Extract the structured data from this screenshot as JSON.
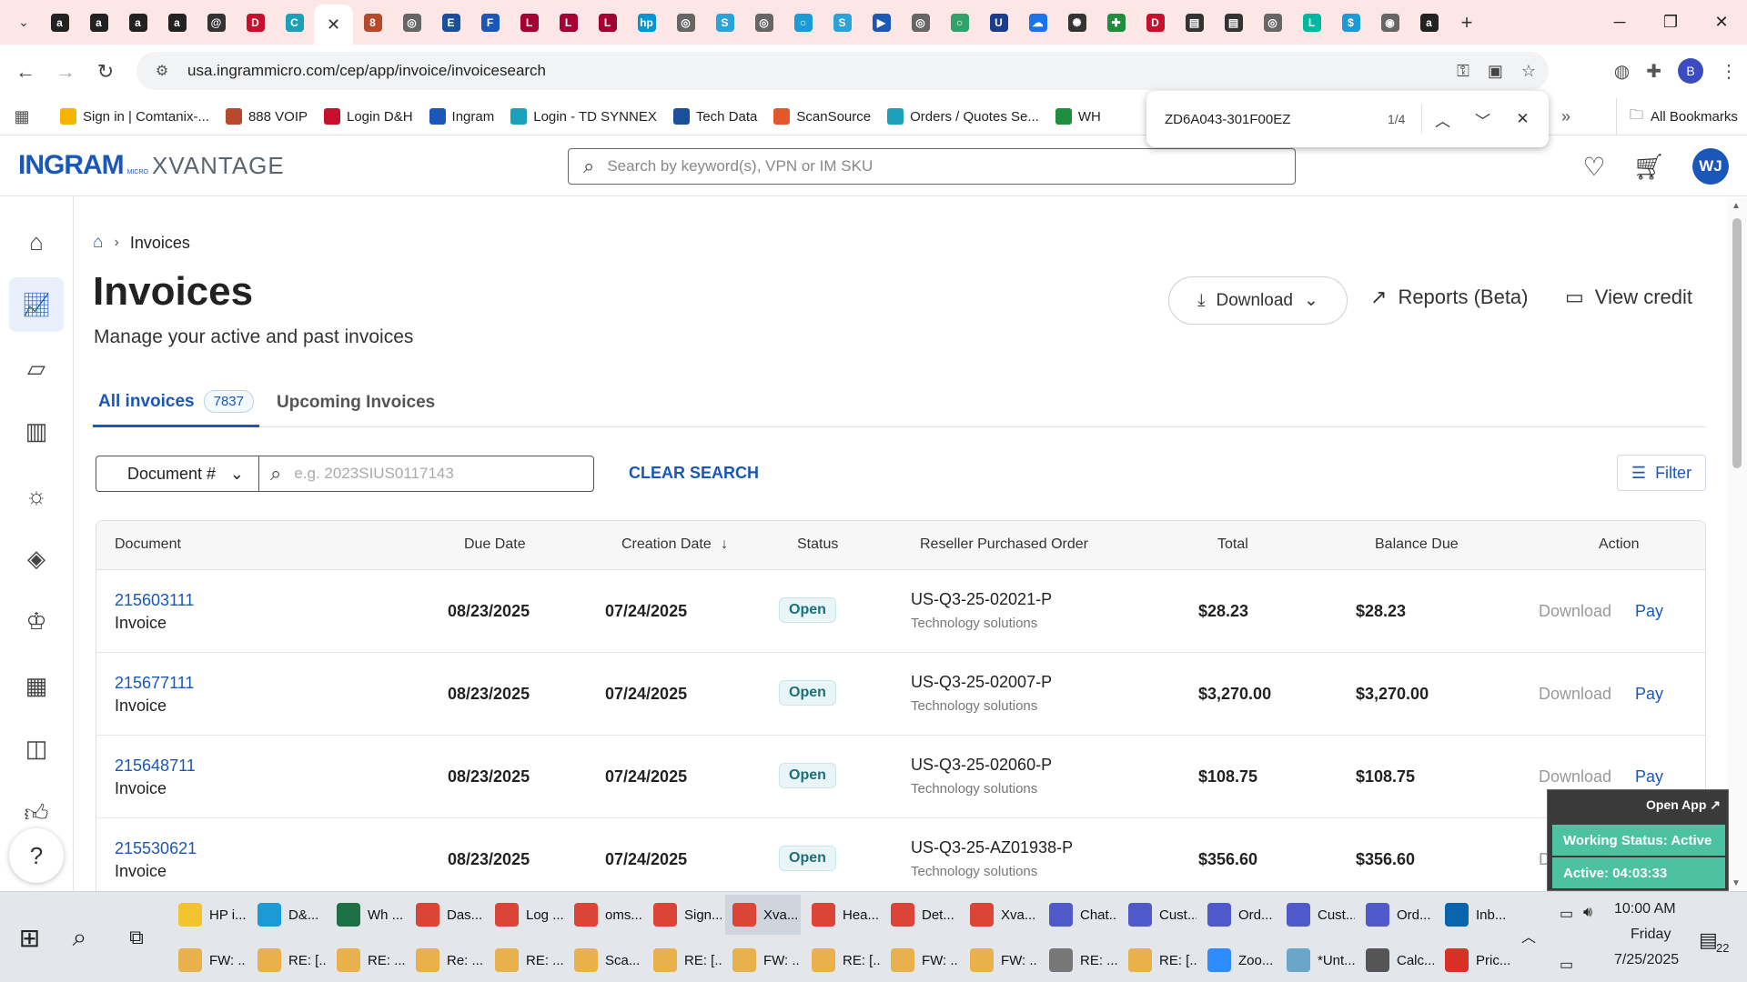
{
  "browser": {
    "tabs": [
      {
        "icon": "amazon-icon",
        "glyph": "a",
        "color": "#222"
      },
      {
        "icon": "amazon-icon",
        "glyph": "a",
        "color": "#222"
      },
      {
        "icon": "amazon-icon",
        "glyph": "a",
        "color": "#222"
      },
      {
        "icon": "amazon-icon",
        "glyph": "a",
        "color": "#222"
      },
      {
        "icon": "at-icon",
        "glyph": "@",
        "color": "#333"
      },
      {
        "icon": "dh-icon",
        "glyph": "D",
        "color": "#c8102e"
      },
      {
        "icon": "comtanix-icon",
        "glyph": "C",
        "color": "#1aa0b8"
      },
      {
        "icon": "scansource-icon",
        "glyph": "S",
        "color": "#e2572b"
      },
      {
        "icon": "voip-icon",
        "glyph": "8",
        "color": "#b5482d"
      },
      {
        "icon": "globe-icon",
        "glyph": "◎",
        "color": "#666"
      },
      {
        "icon": "etn-icon",
        "glyph": "E",
        "color": "#1a4f9c"
      },
      {
        "icon": "form-icon",
        "glyph": "F",
        "color": "#1a57b8"
      },
      {
        "icon": "lg-icon",
        "glyph": "L",
        "color": "#a50034"
      },
      {
        "icon": "lg-icon",
        "glyph": "L",
        "color": "#a50034"
      },
      {
        "icon": "lg-icon",
        "glyph": "L",
        "color": "#a50034"
      },
      {
        "icon": "hp-icon",
        "glyph": "hp",
        "color": "#0096d6"
      },
      {
        "icon": "globe-icon",
        "glyph": "◎",
        "color": "#666"
      },
      {
        "icon": "synnex-icon",
        "glyph": "S",
        "color": "#2aa3d8"
      },
      {
        "icon": "globe-icon",
        "glyph": "◎",
        "color": "#666"
      },
      {
        "icon": "circle-icon",
        "glyph": "○",
        "color": "#1a9bd7"
      },
      {
        "icon": "synnex-icon",
        "glyph": "S",
        "color": "#2aa3d8"
      },
      {
        "icon": "arrow-icon",
        "glyph": "▶",
        "color": "#1a57b8"
      },
      {
        "icon": "globe-icon",
        "glyph": "◎",
        "color": "#666"
      },
      {
        "icon": "circle-icon",
        "glyph": "○",
        "color": "#2fa36b"
      },
      {
        "icon": "u-icon",
        "glyph": "U",
        "color": "#1a3c8f"
      },
      {
        "icon": "cloud-icon",
        "glyph": "☁",
        "color": "#1a73e8"
      },
      {
        "icon": "openai-icon",
        "glyph": "✺",
        "color": "#333"
      },
      {
        "icon": "plus-green-icon",
        "glyph": "✚",
        "color": "#1e8e3e"
      },
      {
        "icon": "dh-icon",
        "glyph": "D",
        "color": "#c8102e"
      },
      {
        "icon": "chart-icon",
        "glyph": "▤",
        "color": "#333"
      },
      {
        "icon": "chart-icon",
        "glyph": "▤",
        "color": "#333"
      },
      {
        "icon": "globe-icon",
        "glyph": "◎",
        "color": "#666"
      },
      {
        "icon": "logi-icon",
        "glyph": "L",
        "color": "#00b8a0"
      },
      {
        "icon": "dollar-icon",
        "glyph": "$",
        "color": "#1a9bd7"
      },
      {
        "icon": "chrome-icon",
        "glyph": "◉",
        "color": "#666"
      },
      {
        "icon": "amazon-icon",
        "glyph": "a",
        "color": "#222"
      }
    ],
    "active_tab_index": 7,
    "url": "usa.ingrammicro.com/cep/app/invoice/invoicesearch",
    "profile_letter": "B",
    "bookmarks": [
      {
        "label": "Sign in | Comtanix-...",
        "color": "#f4b400"
      },
      {
        "label": "888 VOIP",
        "color": "#b5482d"
      },
      {
        "label": "Login D&H",
        "color": "#c8102e"
      },
      {
        "label": "Ingram",
        "color": "#1a57b8"
      },
      {
        "label": "Login - TD SYNNEX",
        "color": "#1aa0b8"
      },
      {
        "label": "Tech Data",
        "color": "#1a4f9c"
      },
      {
        "label": "ScanSource",
        "color": "#e2572b"
      },
      {
        "label": "Orders / Quotes Se...",
        "color": "#1aa0b8"
      },
      {
        "label": "WH",
        "color": "#1e8e3e"
      }
    ],
    "all_bookmarks_label": "All Bookmarks",
    "find": {
      "query": "ZD6A043-301F00EZ",
      "count": "1/4"
    }
  },
  "site": {
    "logo_main": "INGRAM",
    "logo_micro": "MICRO",
    "logo_product": "XVANTAGE",
    "search_placeholder": "Search by keyword(s), VPN or IM SKU",
    "avatar_initials": "WJ"
  },
  "page": {
    "breadcrumb": "Invoices",
    "title": "Invoices",
    "subtitle": "Manage your active and past invoices",
    "download_label": "Download",
    "reports_label": "Reports (Beta)",
    "view_credit_label": "View credit",
    "tabs": [
      {
        "label": "All invoices",
        "count": "7837"
      },
      {
        "label": "Upcoming Invoices"
      }
    ],
    "search_type": "Document #",
    "search_placeholder": "e.g. 2023SIUS0117143",
    "clear_search": "CLEAR SEARCH",
    "filter": "Filter"
  },
  "table": {
    "columns": [
      "Document",
      "Due Date",
      "Creation Date",
      "Status",
      "Reseller Purchased Order",
      "Total",
      "Balance Due",
      "Action"
    ],
    "rows": [
      {
        "doc": "215603111",
        "type": "Invoice",
        "due": "08/23/2025",
        "created": "07/24/2025",
        "status": "Open",
        "po": "US-Q3-25-02021-P",
        "po_sub": "Technology solutions",
        "total": "$28.23",
        "balance": "$28.23",
        "download": "Download",
        "pay": "Pay"
      },
      {
        "doc": "215677111",
        "type": "Invoice",
        "due": "08/23/2025",
        "created": "07/24/2025",
        "status": "Open",
        "po": "US-Q3-25-02007-P",
        "po_sub": "Technology solutions",
        "total": "$3,270.00",
        "balance": "$3,270.00",
        "download": "Download",
        "pay": "Pay"
      },
      {
        "doc": "215648711",
        "type": "Invoice",
        "due": "08/23/2025",
        "created": "07/24/2025",
        "status": "Open",
        "po": "US-Q3-25-02060-P",
        "po_sub": "Technology solutions",
        "total": "$108.75",
        "balance": "$108.75",
        "download": "Download",
        "pay": "Pay"
      },
      {
        "doc": "215530621",
        "type": "Invoice",
        "due": "08/23/2025",
        "created": "07/24/2025",
        "status": "Open",
        "po": "US-Q3-25-AZ01938-P",
        "po_sub": "Technology solutions",
        "total": "$356.60",
        "balance": "$356.60",
        "download": "Download",
        "pay": "Pay"
      }
    ]
  },
  "overlay": {
    "open_app": "Open App ↗",
    "working_status": "Working Status: Active",
    "active_time": "Active: 04:03:33"
  },
  "taskbar": {
    "row1": [
      {
        "label": "HP i...",
        "icon": "folder-icon",
        "color": "#f4c430"
      },
      {
        "label": "D&...",
        "icon": "edge-icon",
        "color": "#1a9bd7"
      },
      {
        "label": "Wh ...",
        "icon": "excel-icon",
        "color": "#1e7145"
      },
      {
        "label": "Das...",
        "icon": "chrome-icon",
        "color": "#db4437"
      },
      {
        "label": "Log ...",
        "icon": "chrome-icon",
        "color": "#db4437"
      },
      {
        "label": "oms...",
        "icon": "chrome-icon",
        "color": "#db4437"
      },
      {
        "label": "Sign...",
        "icon": "chrome-icon",
        "color": "#db4437"
      },
      {
        "label": "Xva...",
        "icon": "chrome-icon",
        "color": "#db4437"
      },
      {
        "label": "Hea...",
        "icon": "chrome-icon",
        "color": "#db4437"
      },
      {
        "label": "Det...",
        "icon": "chrome-icon",
        "color": "#db4437"
      },
      {
        "label": "Xva...",
        "icon": "chrome-icon",
        "color": "#db4437"
      },
      {
        "label": "Chat...",
        "icon": "teams-icon",
        "color": "#5059c9"
      },
      {
        "label": "Cust...",
        "icon": "teams-icon",
        "color": "#5059c9"
      },
      {
        "label": "Ord...",
        "icon": "teams-icon",
        "color": "#5059c9"
      },
      {
        "label": "Cust...",
        "icon": "teams-icon",
        "color": "#5059c9"
      },
      {
        "label": "Ord...",
        "icon": "teams-icon",
        "color": "#5059c9"
      },
      {
        "label": "Inb...",
        "icon": "outlook-icon",
        "color": "#0a64ad"
      }
    ],
    "row2": [
      {
        "label": "FW: ...",
        "icon": "mail-icon",
        "color": "#e8b14b"
      },
      {
        "label": "RE: [...",
        "icon": "mail-icon",
        "color": "#e8b14b"
      },
      {
        "label": "RE: ...",
        "icon": "mail-icon",
        "color": "#e8b14b"
      },
      {
        "label": "Re: ...",
        "icon": "mail-icon",
        "color": "#e8b14b"
      },
      {
        "label": "RE: ...",
        "icon": "mail-icon",
        "color": "#e8b14b"
      },
      {
        "label": "Sca...",
        "icon": "mail-icon",
        "color": "#e8b14b"
      },
      {
        "label": "RE: [...",
        "icon": "mail-icon",
        "color": "#e8b14b"
      },
      {
        "label": "FW: ...",
        "icon": "mail-icon",
        "color": "#e8b14b"
      },
      {
        "label": "RE: [...",
        "icon": "mail-icon",
        "color": "#e8b14b"
      },
      {
        "label": "FW: ...",
        "icon": "mail-icon",
        "color": "#e8b14b"
      },
      {
        "label": "FW: ...",
        "icon": "mail-icon",
        "color": "#e8b14b"
      },
      {
        "label": "RE: ...",
        "icon": "mail-icon",
        "color": "#777"
      },
      {
        "label": "RE: [...",
        "icon": "mail-icon",
        "color": "#e8b14b"
      },
      {
        "label": "Zoo...",
        "icon": "zoom-icon",
        "color": "#2d8cff"
      },
      {
        "label": "*Unt...",
        "icon": "notepad-icon",
        "color": "#6aa6c8"
      },
      {
        "label": "Calc...",
        "icon": "calculator-icon",
        "color": "#555"
      },
      {
        "label": "Pric...",
        "icon": "pdf-icon",
        "color": "#d93025"
      }
    ],
    "time": "10:00 AM",
    "day": "Friday",
    "date": "7/25/2025",
    "notifications": "22"
  }
}
